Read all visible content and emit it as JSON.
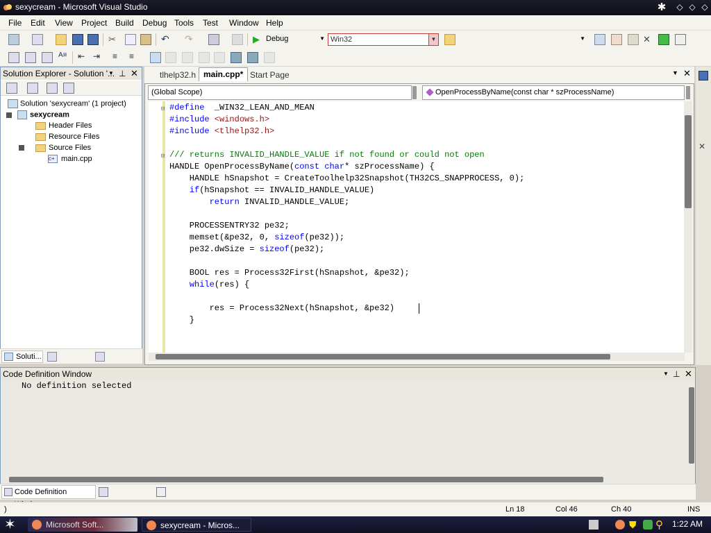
{
  "window": {
    "title": "sexycream - Microsoft Visual Studio"
  },
  "menu": [
    "File",
    "Edit",
    "View",
    "Project",
    "Build",
    "Debug",
    "Tools",
    "Test",
    "Window",
    "Help"
  ],
  "toolbar": {
    "config": "Debug",
    "platform": "Win32"
  },
  "solution_explorer": {
    "title": "Solution Explorer - Solution '...",
    "solution": "Solution 'sexycream' (1 project)",
    "project": "sexycream",
    "folders": [
      "Header Files",
      "Resource Files",
      "Source Files"
    ],
    "file": "main.cpp",
    "bottom_tab": "Soluti..."
  },
  "editor": {
    "tabs": [
      "tlhelp32.h",
      "main.cpp*",
      "Start Page"
    ],
    "scope_left": "(Global Scope)",
    "scope_right": "OpenProcessByName(const char * szProcessName)",
    "lines": [
      [
        [
          "kw",
          "#define"
        ],
        [
          "",
          "  _WIN32_LEAN_AND_MEAN"
        ]
      ],
      [
        [
          "kw",
          "#include"
        ],
        [
          "",
          " "
        ],
        [
          "st",
          "<windows.h>"
        ]
      ],
      [
        [
          "kw",
          "#include"
        ],
        [
          "",
          " "
        ],
        [
          "st",
          "<tlhelp32.h>"
        ]
      ],
      [
        [
          "",
          ""
        ]
      ],
      [
        [
          "cm",
          "/// returns INVALID_HANDLE_VALUE if not found or could not open"
        ]
      ],
      [
        [
          "",
          "HANDLE OpenProcessByName("
        ],
        [
          "kw",
          "const"
        ],
        [
          "",
          " "
        ],
        [
          "kw",
          "char"
        ],
        [
          "",
          "* szProcessName) {"
        ]
      ],
      [
        [
          "",
          "    HANDLE hSnapshot = CreateToolhelp32Snapshot(TH32CS_SNAPPROCESS, 0);"
        ]
      ],
      [
        [
          "",
          "    "
        ],
        [
          "kw",
          "if"
        ],
        [
          "",
          "(hSnapshot == INVALID_HANDLE_VALUE)"
        ]
      ],
      [
        [
          "",
          "        "
        ],
        [
          "kw",
          "return"
        ],
        [
          "",
          " INVALID_HANDLE_VALUE;"
        ]
      ],
      [
        [
          "",
          ""
        ]
      ],
      [
        [
          "",
          "    PROCESSENTRY32 pe32;"
        ]
      ],
      [
        [
          "",
          "    memset(&pe32, 0, "
        ],
        [
          "kw",
          "sizeof"
        ],
        [
          "",
          "(pe32));"
        ]
      ],
      [
        [
          "",
          "    pe32.dwSize = "
        ],
        [
          "kw",
          "sizeof"
        ],
        [
          "",
          "(pe32);"
        ]
      ],
      [
        [
          "",
          ""
        ]
      ],
      [
        [
          "",
          "    BOOL res = Process32First(hSnapshot, &pe32);"
        ]
      ],
      [
        [
          "",
          "    "
        ],
        [
          "kw",
          "while"
        ],
        [
          "",
          "(res) {"
        ]
      ],
      [
        [
          "",
          ""
        ]
      ],
      [
        [
          "",
          "        res = Process32Next(hSnapshot, &pe32)"
        ]
      ],
      [
        [
          "",
          "    }"
        ]
      ]
    ]
  },
  "code_definition": {
    "title": "Code Definition Window",
    "content": "No definition selected",
    "tab": "Code Definition Window"
  },
  "status": {
    "left": ")",
    "ln": "Ln 18",
    "col": "Col 46",
    "ch": "Ch 40",
    "mode": "INS"
  },
  "taskbar": {
    "btn1": "Microsoft Soft...",
    "btn2": "sexycream - Micros...",
    "time": "1:22 AM"
  }
}
